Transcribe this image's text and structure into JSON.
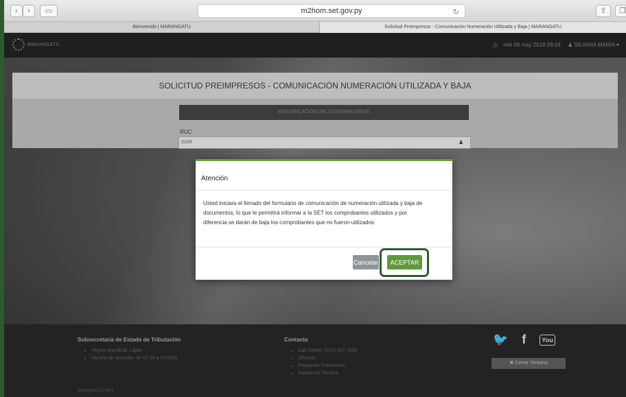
{
  "browser": {
    "url": "m2hom.set.gov.py",
    "tabs": [
      {
        "label": "Bienvenido | MARANGATU"
      },
      {
        "label": "Solicitud Preimpresos - Comunicación Numeración Utilizada y Baja | MARANGATU"
      }
    ],
    "icons": {
      "back": "chevron-left-icon",
      "forward": "chevron-right-icon",
      "sidebar": "sidebar-icon",
      "reload": "reload-icon",
      "share": "share-icon",
      "tabs": "tabs-icon"
    }
  },
  "header": {
    "logo_text": "MARANGATU",
    "datetime": "mié 09 may 2018 09:04",
    "user": "SILVANA MARIA"
  },
  "page": {
    "title": "SOLICITUD PREIMPRESOS - COMUNICACIÓN NUMERACIÓN UTILIZADA Y BAJA",
    "section_title": "IDENTIFICACIÓN DEL CONTRIBUYENTE",
    "ruc_label": "RUC",
    "ruc_value": "3208"
  },
  "modal": {
    "title": "Atención",
    "message": "Usted iniciara el llenado del formulario de comunicación de numeración utilizada y baja de documentos, lo que le permitirá informar a la SET los comprobantes utilizados y por diferencia se darán de baja los comprobantes que no fueron utilizados",
    "cancel_label": "Cancelar",
    "accept_label": "ACEPTAR",
    "accent_color": "#5d9a3c",
    "highlight_color": "#2f5a2c"
  },
  "footer": {
    "col1_title": "Subsecretaría de Estado de Tributación",
    "col1_items": [
      "Yegros esq Mcal. López",
      "Horario de Atención: de 07:30 a 13:00hs"
    ],
    "col2_title": "Contacto",
    "col2_items": [
      "Call Center: (021) 417 7000",
      "Oficinas",
      "Preguntas Frecuentes",
      "Asistencia Técnica"
    ],
    "close_window": "✖ Cerrar Ventana",
    "version": "Marangatu 2.1.34.4"
  }
}
